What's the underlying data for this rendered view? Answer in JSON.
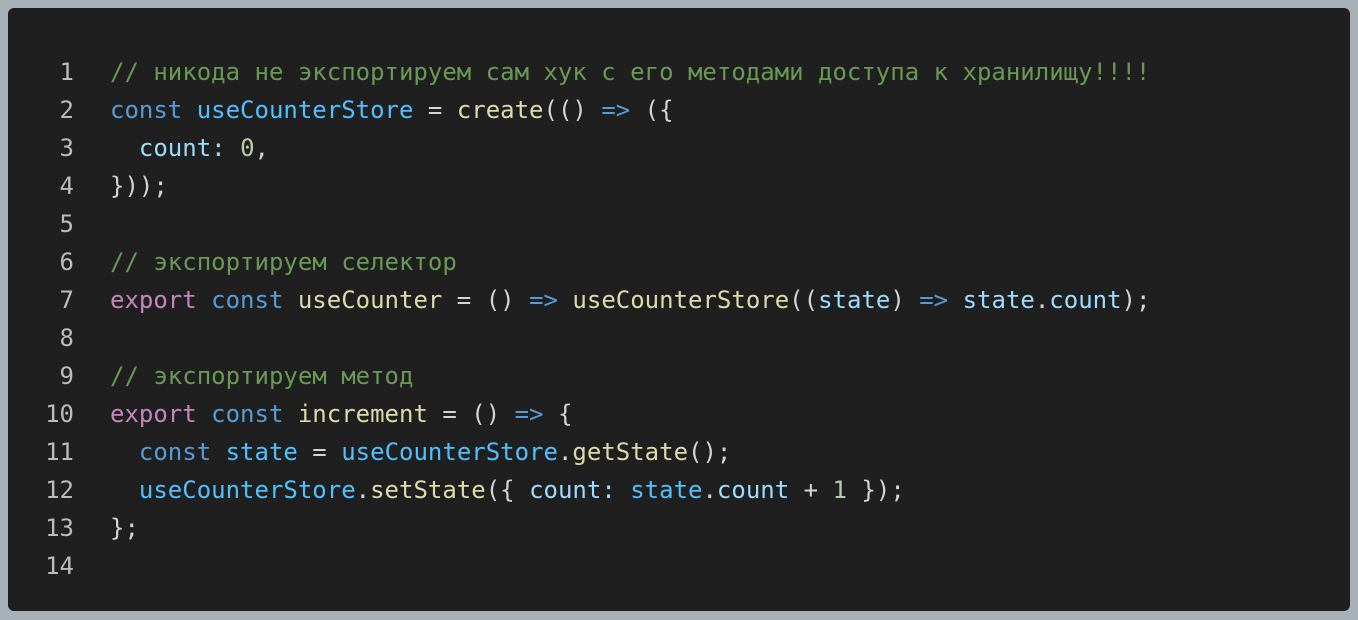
{
  "colors": {
    "background": "#1f1f1f",
    "line_number": "#bcbcbc",
    "comment": "#6a9955",
    "keyword": "#569cd6",
    "export_keyword": "#c586c0",
    "function": "#dcdcaa",
    "variable": "#9cdcfe",
    "constant": "#4fc1ff",
    "number": "#b5cea8",
    "punctuation": "#d4d4d4"
  },
  "lines": [
    {
      "n": "1",
      "tokens": [
        {
          "t": "// никода не экспортируем сам хук с его методами доступа к хранилищу!!!!",
          "c": "comment"
        }
      ]
    },
    {
      "n": "2",
      "tokens": [
        {
          "t": "const",
          "c": "keyword"
        },
        {
          "t": " ",
          "c": "punct"
        },
        {
          "t": "useCounterStore",
          "c": "const"
        },
        {
          "t": " = ",
          "c": "punct"
        },
        {
          "t": "create",
          "c": "func"
        },
        {
          "t": "(() ",
          "c": "punct"
        },
        {
          "t": "=>",
          "c": "keyword"
        },
        {
          "t": " ({",
          "c": "punct"
        }
      ]
    },
    {
      "n": "3",
      "tokens": [
        {
          "t": "  ",
          "c": "punct"
        },
        {
          "t": "count",
          "c": "var"
        },
        {
          "t": ": ",
          "c": "var"
        },
        {
          "t": "0",
          "c": "number"
        },
        {
          "t": ",",
          "c": "punct"
        }
      ]
    },
    {
      "n": "4",
      "tokens": [
        {
          "t": "}));",
          "c": "punct"
        }
      ]
    },
    {
      "n": "5",
      "tokens": []
    },
    {
      "n": "6",
      "tokens": [
        {
          "t": "// экспортируем селектор",
          "c": "comment"
        }
      ]
    },
    {
      "n": "7",
      "tokens": [
        {
          "t": "export",
          "c": "export"
        },
        {
          "t": " ",
          "c": "punct"
        },
        {
          "t": "const",
          "c": "keyword"
        },
        {
          "t": " ",
          "c": "punct"
        },
        {
          "t": "useCounter",
          "c": "func"
        },
        {
          "t": " = () ",
          "c": "punct"
        },
        {
          "t": "=>",
          "c": "keyword"
        },
        {
          "t": " ",
          "c": "punct"
        },
        {
          "t": "useCounterStore",
          "c": "func"
        },
        {
          "t": "((",
          "c": "punct"
        },
        {
          "t": "state",
          "c": "var"
        },
        {
          "t": ") ",
          "c": "punct"
        },
        {
          "t": "=>",
          "c": "keyword"
        },
        {
          "t": " ",
          "c": "punct"
        },
        {
          "t": "state",
          "c": "var"
        },
        {
          "t": ".",
          "c": "punct"
        },
        {
          "t": "count",
          "c": "var"
        },
        {
          "t": ");",
          "c": "punct"
        }
      ]
    },
    {
      "n": "8",
      "tokens": []
    },
    {
      "n": "9",
      "tokens": [
        {
          "t": "// экспортируем метод",
          "c": "comment"
        }
      ]
    },
    {
      "n": "10",
      "tokens": [
        {
          "t": "export",
          "c": "export"
        },
        {
          "t": " ",
          "c": "punct"
        },
        {
          "t": "const",
          "c": "keyword"
        },
        {
          "t": " ",
          "c": "punct"
        },
        {
          "t": "increment",
          "c": "func"
        },
        {
          "t": " = () ",
          "c": "punct"
        },
        {
          "t": "=>",
          "c": "keyword"
        },
        {
          "t": " {",
          "c": "punct"
        }
      ]
    },
    {
      "n": "11",
      "tokens": [
        {
          "t": "  ",
          "c": "punct"
        },
        {
          "t": "const",
          "c": "keyword"
        },
        {
          "t": " ",
          "c": "punct"
        },
        {
          "t": "state",
          "c": "const"
        },
        {
          "t": " = ",
          "c": "punct"
        },
        {
          "t": "useCounterStore",
          "c": "const"
        },
        {
          "t": ".",
          "c": "punct"
        },
        {
          "t": "getState",
          "c": "func"
        },
        {
          "t": "();",
          "c": "punct"
        }
      ]
    },
    {
      "n": "12",
      "tokens": [
        {
          "t": "  ",
          "c": "punct"
        },
        {
          "t": "useCounterStore",
          "c": "const"
        },
        {
          "t": ".",
          "c": "punct"
        },
        {
          "t": "setState",
          "c": "func"
        },
        {
          "t": "({ ",
          "c": "punct"
        },
        {
          "t": "count",
          "c": "var"
        },
        {
          "t": ": ",
          "c": "var"
        },
        {
          "t": "state",
          "c": "const"
        },
        {
          "t": ".",
          "c": "punct"
        },
        {
          "t": "count",
          "c": "var"
        },
        {
          "t": " + ",
          "c": "punct"
        },
        {
          "t": "1",
          "c": "number"
        },
        {
          "t": " });",
          "c": "punct"
        }
      ]
    },
    {
      "n": "13",
      "tokens": [
        {
          "t": "};",
          "c": "punct"
        }
      ]
    },
    {
      "n": "14",
      "tokens": []
    }
  ]
}
